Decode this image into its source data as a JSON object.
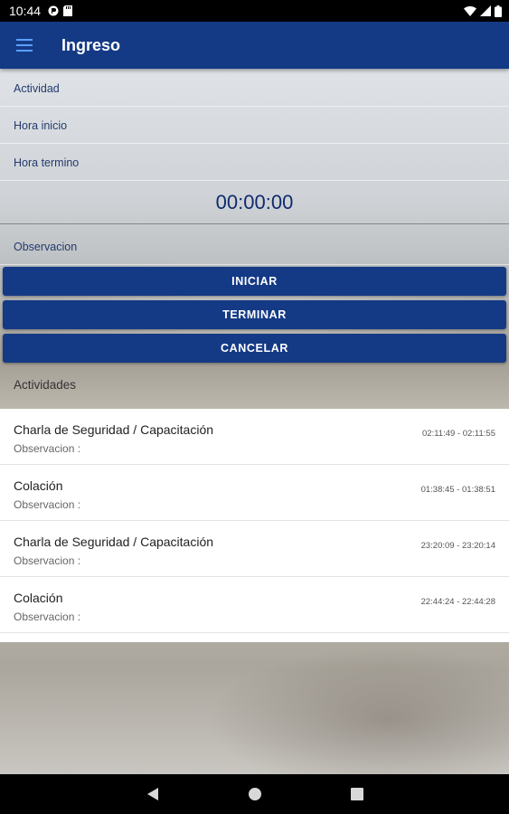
{
  "status_bar": {
    "time": "10:44"
  },
  "app_bar": {
    "title": "Ingreso"
  },
  "form": {
    "actividad_label": "Actividad",
    "hora_inicio_label": "Hora inicio",
    "hora_termino_label": "Hora termino",
    "timer": "00:00:00",
    "observacion_label": "Observacion"
  },
  "buttons": {
    "iniciar": "INICIAR",
    "terminar": "TERMINAR",
    "cancelar": "CANCELAR"
  },
  "activities": {
    "section_title": "Actividades",
    "items": [
      {
        "title": "Charla de Seguridad / Capacitación",
        "obs": "Observacion :",
        "time": "02:11:49 - 02:11:55"
      },
      {
        "title": "Colación",
        "obs": "Observacion :",
        "time": "01:38:45 - 01:38:51"
      },
      {
        "title": "Charla de Seguridad / Capacitación",
        "obs": "Observacion :",
        "time": "23:20:09 - 23:20:14"
      },
      {
        "title": "Colación",
        "obs": "Observacion :",
        "time": "22:44:24 - 22:44:28"
      }
    ]
  },
  "colors": {
    "primary": "#143a86",
    "list_bg": "#ffffff"
  },
  "icons": [
    "menu-icon",
    "back-nav-icon",
    "home-nav-icon",
    "recents-nav-icon",
    "wifi-icon",
    "signal-icon",
    "battery-icon"
  ]
}
